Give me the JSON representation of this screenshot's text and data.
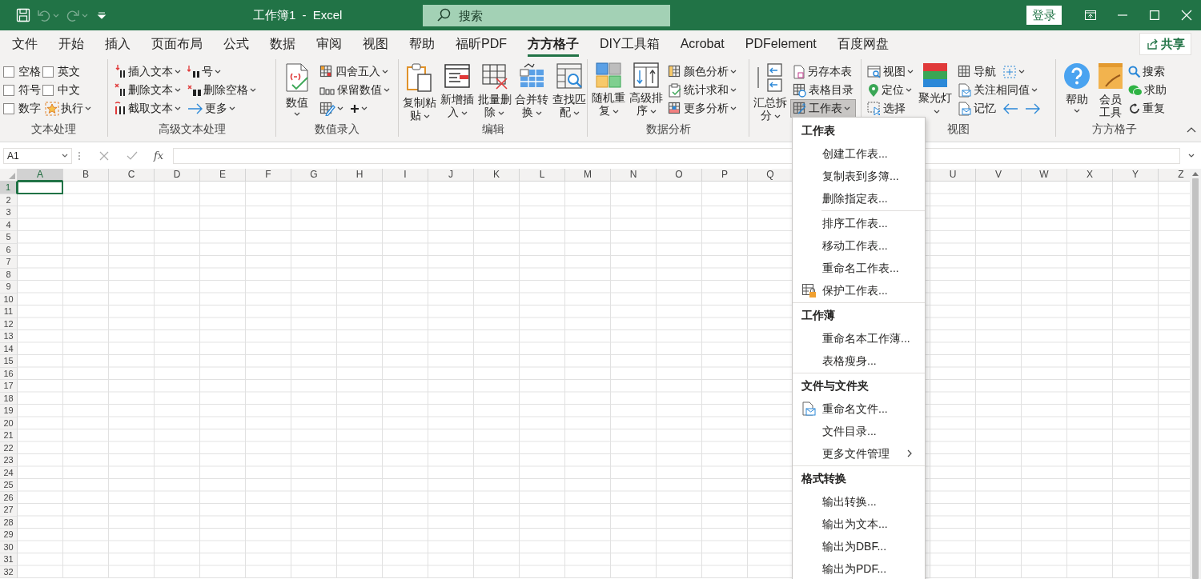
{
  "window": {
    "title": "工作簿1 - Excel",
    "login": "登录"
  },
  "quick_access": [
    {
      "kind": "save",
      "disabled": false,
      "dropdown": false
    },
    {
      "kind": "undo",
      "disabled": true,
      "dropdown": true
    },
    {
      "kind": "redo",
      "disabled": true,
      "dropdown": true
    },
    {
      "kind": "customize",
      "disabled": false,
      "dropdown": false
    }
  ],
  "search": {
    "placeholder": "搜索"
  },
  "tabs": [
    {
      "label": "文件",
      "selected": false
    },
    {
      "label": "开始",
      "selected": false
    },
    {
      "label": "插入",
      "selected": false
    },
    {
      "label": "页面布局",
      "selected": false
    },
    {
      "label": "公式",
      "selected": false
    },
    {
      "label": "数据",
      "selected": false
    },
    {
      "label": "审阅",
      "selected": false
    },
    {
      "label": "视图",
      "selected": false
    },
    {
      "label": "帮助",
      "selected": false
    },
    {
      "label": "福昕PDF",
      "selected": false
    },
    {
      "label": "方方格子",
      "selected": true
    },
    {
      "label": "DIY工具箱",
      "selected": false
    },
    {
      "label": "Acrobat",
      "selected": false
    },
    {
      "label": "PDFelement",
      "selected": false
    },
    {
      "label": "百度网盘",
      "selected": false
    }
  ],
  "share": "共享",
  "ribbon": [
    {
      "label": "文本处理",
      "items": [
        {
          "kind": "check",
          "label": "空格",
          "checked": false
        },
        {
          "kind": "check",
          "label": "符号",
          "checked": false
        },
        {
          "kind": "check",
          "label": "数字",
          "checked": false
        },
        {
          "kind": "check",
          "label": "英文",
          "checked": false
        },
        {
          "kind": "check",
          "label": "中文",
          "checked": false
        },
        {
          "kind": "small",
          "label": "执行",
          "dropdown": true,
          "expanded": false
        }
      ]
    },
    {
      "label": "高级文本处理",
      "items": [
        {
          "kind": "small",
          "label": "插入文本",
          "dropdown": true,
          "expanded": false
        },
        {
          "kind": "small",
          "label": "删除文本",
          "dropdown": true,
          "expanded": false
        },
        {
          "kind": "small",
          "label": "截取文本",
          "dropdown": true,
          "expanded": false
        },
        {
          "kind": "small",
          "label": "号",
          "dropdown": true,
          "expanded": false
        },
        {
          "kind": "small",
          "label": "删除空格",
          "dropdown": true,
          "expanded": false
        },
        {
          "kind": "small",
          "label": "更多",
          "dropdown": true,
          "expanded": false
        }
      ]
    },
    {
      "label": "数值录入",
      "items": [
        {
          "kind": "large",
          "label": "数值",
          "dropdown": true,
          "expanded": false
        },
        {
          "kind": "small",
          "label": "四舍五入",
          "dropdown": true,
          "expanded": false
        },
        {
          "kind": "small",
          "label": "保留数值",
          "dropdown": true,
          "expanded": false
        },
        {
          "kind": "row",
          "buttons": [
            {
              "dropdown": true,
              "expanded": false
            },
            {
              "dropdown": true,
              "expanded": false
            }
          ]
        }
      ]
    },
    {
      "label": "编辑",
      "items": [
        {
          "kind": "large",
          "label": "复制粘贴",
          "dropdown": true,
          "expanded": false
        },
        {
          "kind": "large",
          "label": "新增插入",
          "dropdown": true,
          "expanded": false
        },
        {
          "kind": "large",
          "label": "批量删除",
          "dropdown": true,
          "expanded": false
        },
        {
          "kind": "large",
          "label": "合并转换",
          "dropdown": true,
          "expanded": false
        },
        {
          "kind": "large",
          "label": "查找匹配",
          "dropdown": true,
          "expanded": false
        }
      ]
    },
    {
      "label": "数据分析",
      "items": [
        {
          "kind": "large",
          "label": "随机重复",
          "dropdown": true,
          "expanded": false
        },
        {
          "kind": "large",
          "label": "高级排序",
          "dropdown": true,
          "expanded": false
        },
        {
          "kind": "small",
          "label": "颜色分析",
          "dropdown": true,
          "expanded": false
        },
        {
          "kind": "small",
          "label": "统计求和",
          "dropdown": true,
          "expanded": false
        },
        {
          "kind": "small",
          "label": "更多分析",
          "dropdown": true,
          "expanded": false
        }
      ]
    },
    {
      "items": [
        {
          "kind": "large",
          "label": "汇总拆分",
          "dropdown": true,
          "expanded": false
        },
        {
          "kind": "small",
          "label": "另存本表",
          "dropdown": false
        },
        {
          "kind": "small",
          "label": "表格目录",
          "dropdown": false
        },
        {
          "kind": "small",
          "label": "工作表",
          "dropdown": true,
          "expanded": true
        }
      ]
    },
    {
      "label": "视图",
      "items": [
        {
          "kind": "small",
          "label": "视图",
          "dropdown": true,
          "expanded": false
        },
        {
          "kind": "small",
          "label": "定位",
          "dropdown": true,
          "expanded": false
        },
        {
          "kind": "small",
          "label": "选择",
          "dropdown": false
        },
        {
          "kind": "large",
          "label": "聚光灯",
          "dropdown": true,
          "expanded": false
        },
        {
          "kind": "row",
          "buttons": [
            {
              "label": "导航",
              "dropdown": false
            },
            {
              "dropdown": true,
              "expanded": false
            }
          ]
        },
        {
          "kind": "small",
          "label": "关注相同值",
          "dropdown": true,
          "expanded": false
        },
        {
          "kind": "row",
          "buttons": [
            {
              "label": "记忆",
              "dropdown": false
            },
            {
              "dropdown": false
            },
            {
              "dropdown": false
            }
          ]
        }
      ]
    },
    {
      "label": "方方格子",
      "items": [
        {
          "kind": "large",
          "label": "帮助",
          "dropdown": true,
          "expanded": false
        },
        {
          "kind": "large",
          "label": "会员工具",
          "dropdown": false
        },
        {
          "kind": "small",
          "label": "搜索",
          "dropdown": false
        },
        {
          "kind": "small",
          "label": "求助",
          "dropdown": false
        },
        {
          "kind": "small",
          "label": "重复",
          "dropdown": false
        }
      ]
    }
  ],
  "formula_bar": {
    "name_box": "A1",
    "function_label": "fx"
  },
  "columns": [
    {
      "label": "A",
      "selected": true
    },
    {
      "label": "B",
      "selected": false
    },
    {
      "label": "C",
      "selected": false
    },
    {
      "label": "D",
      "selected": false
    },
    {
      "label": "E",
      "selected": false
    },
    {
      "label": "F",
      "selected": false
    },
    {
      "label": "G",
      "selected": false
    },
    {
      "label": "H",
      "selected": false
    },
    {
      "label": "I",
      "selected": false
    },
    {
      "label": "J",
      "selected": false
    },
    {
      "label": "K",
      "selected": false
    },
    {
      "label": "L",
      "selected": false
    },
    {
      "label": "M",
      "selected": false
    },
    {
      "label": "N",
      "selected": false
    },
    {
      "label": "O",
      "selected": false
    },
    {
      "label": "P",
      "selected": false
    },
    {
      "label": "Q",
      "selected": false
    },
    null,
    null,
    null,
    {
      "label": "U",
      "selected": false
    },
    {
      "label": "V",
      "selected": false
    },
    {
      "label": "W",
      "selected": false
    },
    {
      "label": "X",
      "selected": false
    },
    {
      "label": "Y",
      "selected": false
    },
    {
      "label": "Z",
      "selected": false
    }
  ],
  "rows": [
    {
      "label": "1",
      "selected": true
    },
    {
      "label": "2",
      "selected": false
    },
    {
      "label": "3",
      "selected": false
    },
    {
      "label": "4",
      "selected": false
    },
    {
      "label": "5",
      "selected": false
    },
    {
      "label": "6",
      "selected": false
    },
    {
      "label": "7",
      "selected": false
    },
    {
      "label": "8",
      "selected": false
    },
    {
      "label": "9",
      "selected": false
    },
    {
      "label": "10",
      "selected": false
    },
    {
      "label": "11",
      "selected": false
    },
    {
      "label": "12",
      "selected": false
    },
    {
      "label": "13",
      "selected": false
    },
    {
      "label": "14",
      "selected": false
    },
    {
      "label": "15",
      "selected": false
    },
    {
      "label": "16",
      "selected": false
    },
    {
      "label": "17",
      "selected": false
    },
    {
      "label": "18",
      "selected": false
    },
    {
      "label": "19",
      "selected": false
    },
    {
      "label": "20",
      "selected": false
    },
    {
      "label": "21",
      "selected": false
    },
    {
      "label": "22",
      "selected": false
    },
    {
      "label": "23",
      "selected": false
    },
    {
      "label": "24",
      "selected": false
    },
    {
      "label": "25",
      "selected": false
    },
    {
      "label": "26",
      "selected": false
    },
    {
      "label": "27",
      "selected": false
    },
    {
      "label": "28",
      "selected": false
    },
    {
      "label": "29",
      "selected": false
    },
    {
      "label": "30",
      "selected": false
    },
    {
      "label": "31",
      "selected": false
    },
    {
      "label": "32",
      "selected": false
    }
  ],
  "dropdown_menu": {
    "sections": [
      {
        "heading": "工作表",
        "items": [
          {
            "label": "创建工作表..."
          },
          {
            "label": "复制表到多簿..."
          },
          {
            "label": "删除指定表..."
          },
          {
            "label": "排序工作表...",
            "divider_before": true
          },
          {
            "label": "移动工作表..."
          },
          {
            "label": "重命名工作表..."
          },
          {
            "label": "保护工作表..."
          }
        ]
      },
      {
        "heading": "工作薄",
        "items": [
          {
            "label": "重命名本工作薄..."
          },
          {
            "label": "表格瘦身..."
          }
        ]
      },
      {
        "heading": "文件与文件夹",
        "items": [
          {
            "label": "重命名文件..."
          },
          {
            "label": "文件目录..."
          },
          {
            "label": "更多文件管理",
            "submenu": true
          }
        ]
      },
      {
        "heading": "格式转换",
        "items": [
          {
            "label": "输出转换..."
          },
          {
            "label": "输出为文本..."
          },
          {
            "label": "输出为DBF..."
          },
          {
            "label": "输出为PDF..."
          }
        ]
      }
    ]
  }
}
